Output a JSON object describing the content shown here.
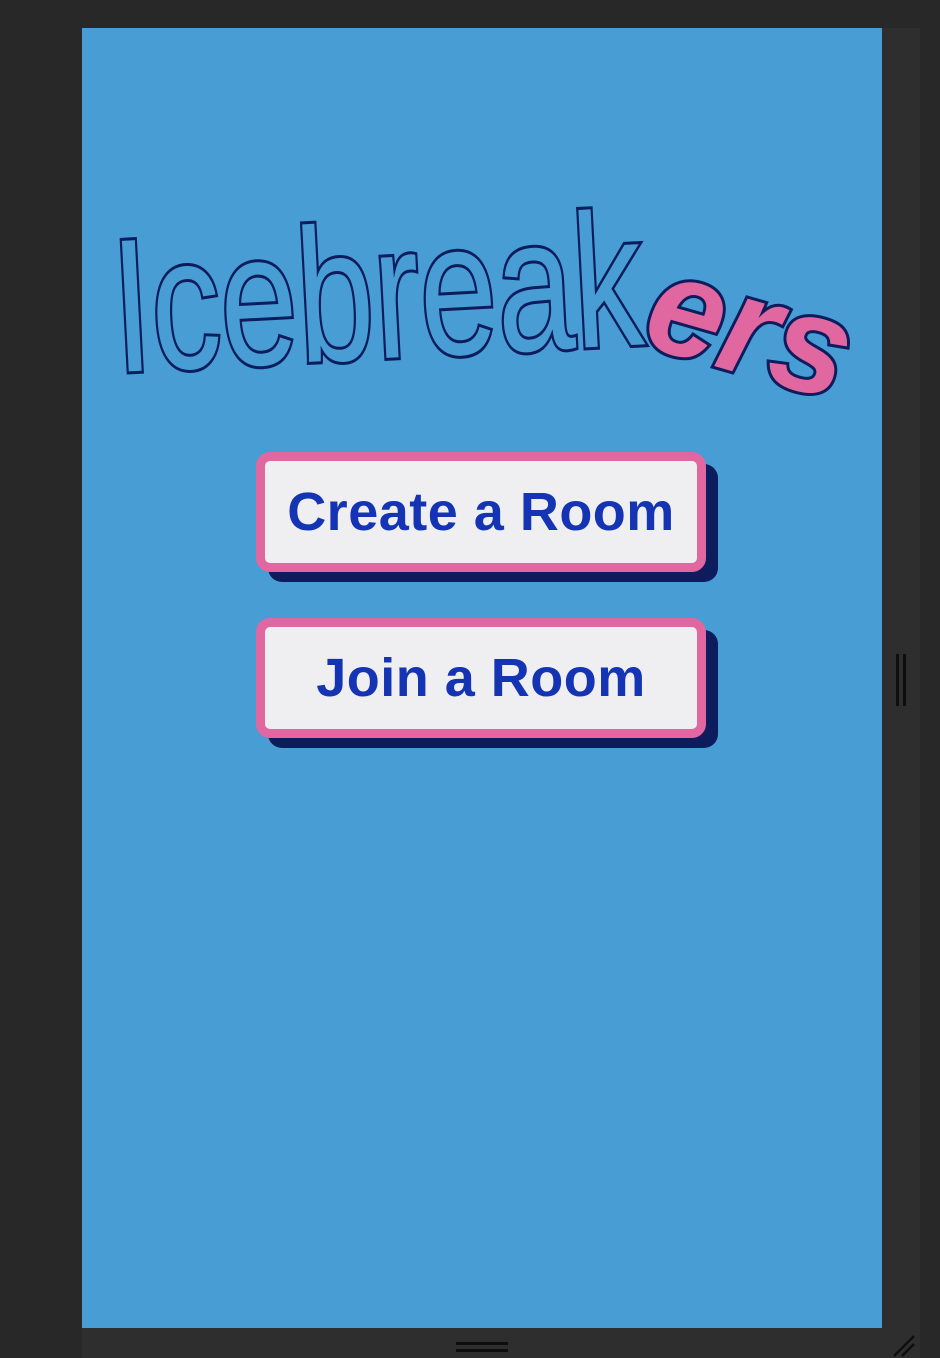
{
  "app": {
    "logo": {
      "part1": "Icebreak",
      "part2": "ers",
      "colors": {
        "part1_fill": "#479dd4",
        "part2_fill": "#e0679f",
        "outline": "#0d1c5c"
      }
    },
    "background_color": "#479dd4"
  },
  "actions": {
    "create_label": "Create a Room",
    "join_label": "Join a Room"
  },
  "theme": {
    "button_bg": "#efeff1",
    "button_border": "#e0679f",
    "button_text": "#1434b4",
    "button_shadow": "#0d1c5c",
    "workspace_bg": "#282828"
  },
  "chrome": {
    "resize_handle_right": "vertical-grip-icon",
    "resize_handle_bottom": "horizontal-grip-icon",
    "resize_corner": "resize-corner-icon"
  }
}
